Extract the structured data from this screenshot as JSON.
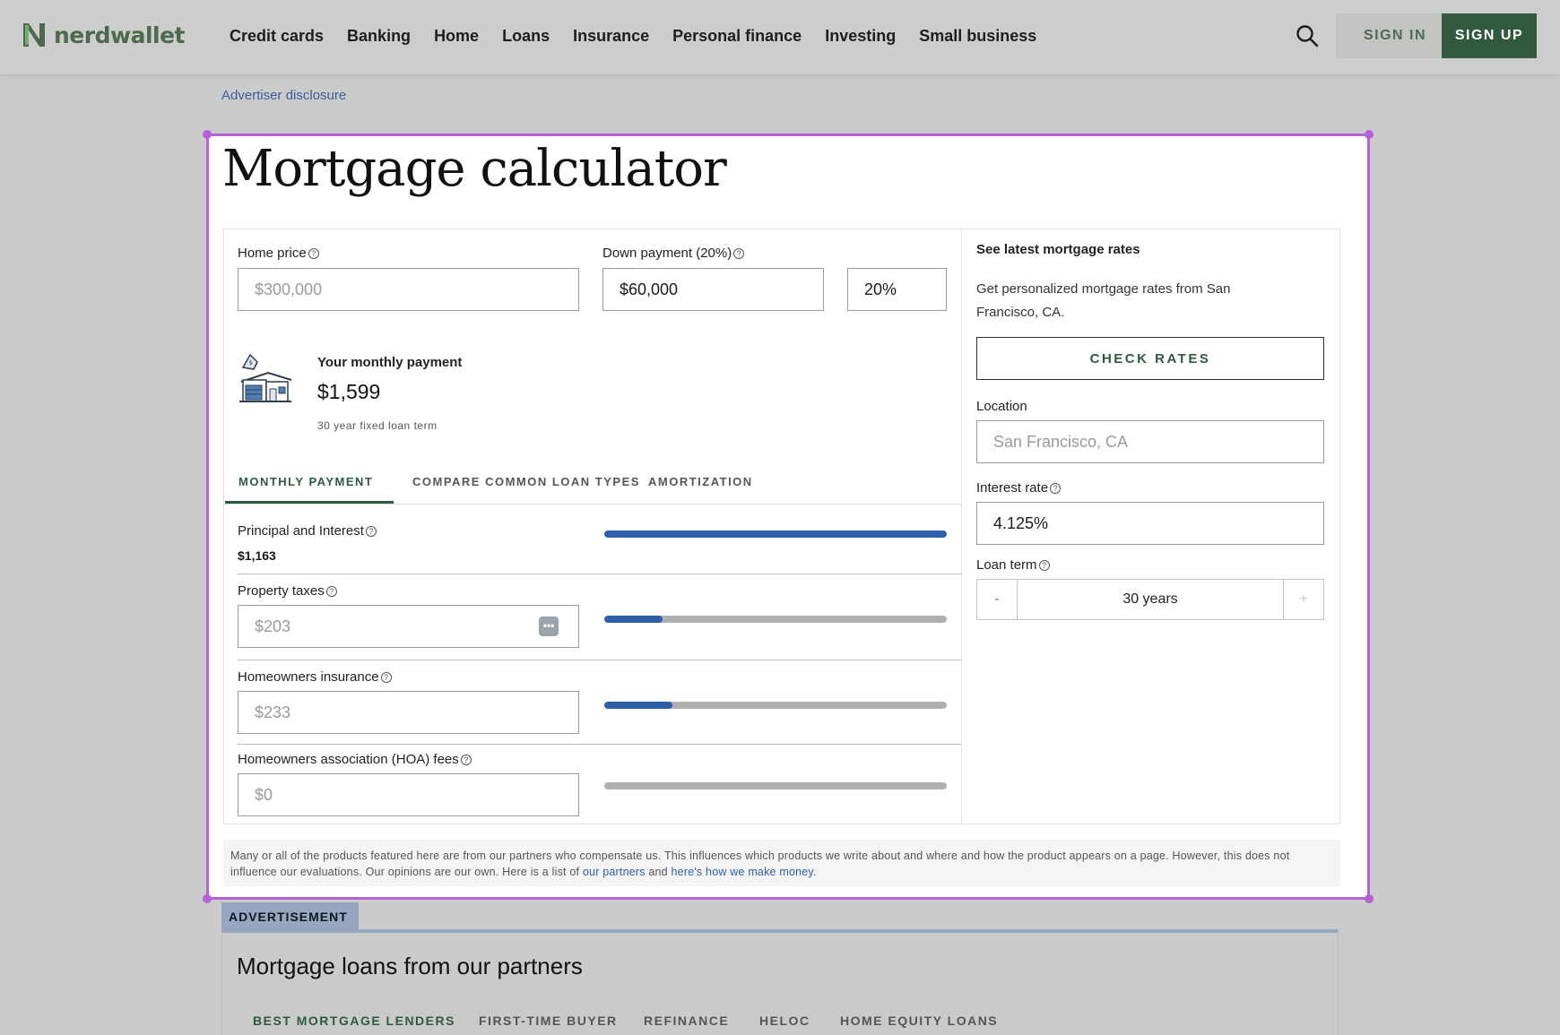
{
  "header": {
    "brand": "nerdwallet",
    "nav": [
      "Credit cards",
      "Banking",
      "Home",
      "Loans",
      "Insurance",
      "Personal finance",
      "Investing",
      "Small business"
    ],
    "signin": "SIGN IN",
    "signup": "SIGN UP"
  },
  "disclosure": "Advertiser disclosure",
  "calculator": {
    "title": "Mortgage calculator",
    "home_price": {
      "label": "Home price",
      "placeholder": "$300,000"
    },
    "down_payment": {
      "label": "Down payment (20%)",
      "amount": "$60,000",
      "percent": "20%"
    },
    "monthly": {
      "title": "Your monthly payment",
      "amount": "$1,599",
      "term": "30 year fixed loan term"
    },
    "tabs": [
      "MONTHLY PAYMENT",
      "COMPARE COMMON LOAN TYPES",
      "AMORTIZATION"
    ],
    "breakdown": {
      "principal": {
        "label": "Principal and Interest",
        "value": "$1,163",
        "fraction": 1.0
      },
      "taxes": {
        "label": "Property taxes",
        "placeholder": "$203",
        "fraction": 0.17
      },
      "insurance": {
        "label": "Homeowners insurance",
        "placeholder": "$233",
        "fraction": 0.2
      },
      "hoa": {
        "label": "Homeowners association (HOA) fees",
        "placeholder": "$0",
        "fraction": 0
      }
    },
    "rates": {
      "title": "See latest mortgage rates",
      "description": "Get personalized mortgage rates from San Francisco, CA.",
      "button": "CHECK RATES",
      "location_label": "Location",
      "location_placeholder": "San Francisco, CA",
      "interest_label": "Interest rate",
      "interest_value": "4.125%",
      "term_label": "Loan term",
      "term_value": "30 years",
      "minus": "-",
      "plus": "+"
    },
    "footnote": {
      "text": "Many or all of the products featured here are from our partners who compensate us. This influences which products we write about and where and how the product appears on a page. However, this does not influence our evaluations. Our opinions are our own. Here is a list of",
      "link1": "our partners",
      "and": "and",
      "link2": "here's how we make money",
      "end": "."
    }
  },
  "ad": {
    "tag": "ADVERTISEMENT",
    "title": "Mortgage loans from our partners",
    "tabs": [
      "BEST MORTGAGE LENDERS",
      "FIRST-TIME BUYER",
      "REFINANCE",
      "HELOC",
      "HOME EQUITY LOANS"
    ]
  },
  "colors": {
    "brand_green": "#2f5a3e",
    "bar_blue": "#2d5fab",
    "selection": "#b562d6"
  }
}
